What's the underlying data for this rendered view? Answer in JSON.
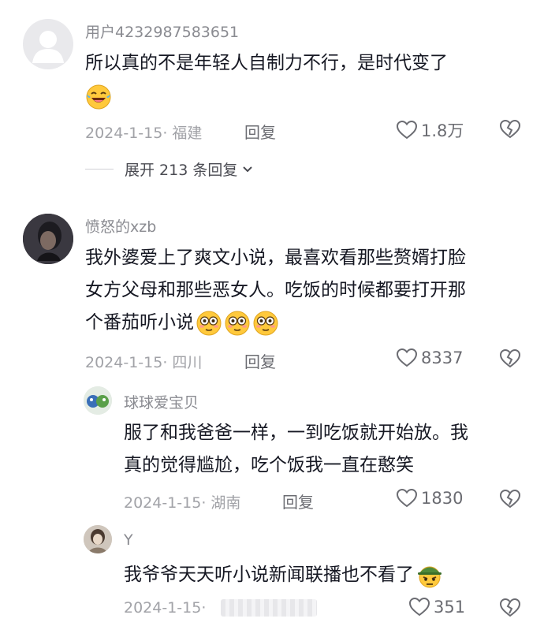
{
  "comments": [
    {
      "username": "用户4232987583651",
      "text": "所以真的不是年轻人自制力不行，是时代变了",
      "meta": "2024-1-15· 福建",
      "reply_label": "回复",
      "likes": "1.8万",
      "expand_label": "展开 213 条回复",
      "emoji": "laughing-crying-emoji"
    },
    {
      "username": "愤怒的xzb",
      "text_line1": "我外婆爱上了爽文小说，最喜欢看那些赘婿打脸",
      "text_line2": "女方父母和那些恶女人。吃饭的时候都要打开那",
      "text_line3": "个番茄听小说",
      "meta": "2024-1-15· 四川",
      "reply_label": "回复",
      "likes": "8337",
      "emoji": "flushed-emoji"
    },
    {
      "username": "球球爱宝贝",
      "text_line1": "服了和我爸爸一样，一到吃饭就开始放。我",
      "text_line2": "真的觉得尴尬，吃个饭我一直在憨笑",
      "meta": "2024-1-15· 湖南",
      "reply_label": "回复",
      "likes": "1830"
    },
    {
      "username": "Y",
      "text": "我爷爷天天听小说新闻联播也不看了",
      "meta": "2024-1-15·",
      "likes": "351",
      "emoji": "soldier-helmet-emoji"
    }
  ],
  "colors": {
    "text": "#161823",
    "meta": "#a1a2a7",
    "username": "#8a8b91",
    "emoji_yellow": "#ffc93c"
  }
}
